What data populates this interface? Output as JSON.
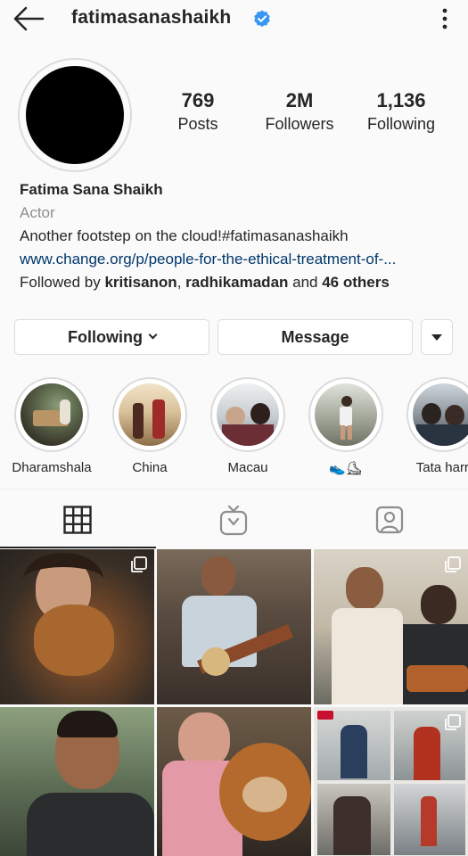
{
  "header": {
    "username": "fatimasanashaikh",
    "back_icon": "arrow-left-icon",
    "verified_icon": "verified-badge-icon",
    "menu_icon": "kebab-menu-icon",
    "verified_color": "#3897f0"
  },
  "stats": {
    "posts": {
      "value": "769",
      "label": "Posts"
    },
    "followers": {
      "value": "2M",
      "label": "Followers"
    },
    "following": {
      "value": "1,136",
      "label": "Following"
    }
  },
  "bio": {
    "name": "Fatima Sana Shaikh",
    "category": "Actor",
    "text": "Another footstep on the cloud!#fatimasanashaikh",
    "link": "www.change.org/p/people-for-the-ethical-treatment-of-...",
    "followed_prefix": "Followed by ",
    "followed_user1": "kritisanon",
    "followed_sep": ", ",
    "followed_user2": "radhikamadan",
    "followed_and": " and ",
    "followed_others": "46 others",
    "link_color": "#00376b"
  },
  "actions": {
    "following_label": "Following",
    "message_label": "Message",
    "more_icon": "caret-down-icon"
  },
  "highlights": [
    {
      "label": "Dharamshala"
    },
    {
      "label": "China"
    },
    {
      "label": "Macau"
    },
    {
      "label": "👟⛸"
    },
    {
      "label": "Tata harri"
    }
  ],
  "tabs": [
    {
      "name": "grid",
      "icon": "grid-icon",
      "active": true
    },
    {
      "name": "igtv",
      "icon": "igtv-icon",
      "active": false
    },
    {
      "name": "tagged",
      "icon": "tagged-user-icon",
      "active": false
    }
  ]
}
